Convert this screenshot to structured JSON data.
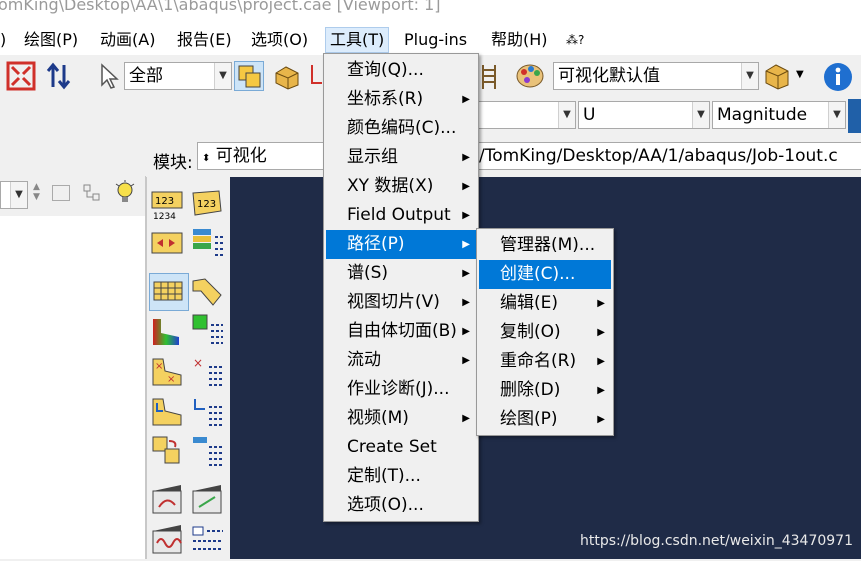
{
  "title": "omKing\\Desktop\\AA\\1\\abaqus\\project.cae [Viewport: 1]",
  "menubar": [
    {
      "label": ")"
    },
    {
      "label": "绘图(P)"
    },
    {
      "label": "动画(A)"
    },
    {
      "label": "报告(E)"
    },
    {
      "label": "选项(O)"
    },
    {
      "label": "工具(T)"
    },
    {
      "label": "Plug-ins"
    },
    {
      "label": "帮助(H)"
    },
    {
      "label": "⁂?"
    }
  ],
  "toolbar": {
    "display_group_combo": "全部",
    "default_combo": "可视化默认值",
    "field_combo": "U",
    "invariant_combo": "Magnitude"
  },
  "module_row": {
    "label": "模块:",
    "module_value": "可视化",
    "odb_path": "/TomKing/Desktop/AA/1/abaqus/Job-1out.c"
  },
  "tools_menu": {
    "items": [
      {
        "label": "查询(Q)...",
        "submenu": false
      },
      {
        "label": "坐标系(R)",
        "submenu": true
      },
      {
        "label": "颜色编码(C)...",
        "submenu": false
      },
      {
        "label": "显示组",
        "submenu": true
      },
      {
        "label": "XY 数据(X)",
        "submenu": true
      },
      {
        "label": "Field Output",
        "submenu": true
      },
      {
        "label": "路径(P)",
        "submenu": true
      },
      {
        "label": "谱(S)",
        "submenu": true
      },
      {
        "label": "视图切片(V)",
        "submenu": true
      },
      {
        "label": "自由体切面(B)",
        "submenu": true
      },
      {
        "label": "流动",
        "submenu": true
      },
      {
        "label": "作业诊断(J)...",
        "submenu": false
      },
      {
        "label": "视频(M)",
        "submenu": true
      },
      {
        "label": "Create Set",
        "submenu": false
      },
      {
        "label": "定制(T)...",
        "submenu": false
      },
      {
        "label": "选项(O)...",
        "submenu": false
      }
    ],
    "highlighted": "路径(P)"
  },
  "path_submenu": {
    "items": [
      {
        "label": "管理器(M)...",
        "submenu": false
      },
      {
        "label": "创建(C)...",
        "submenu": false
      },
      {
        "label": "编辑(E)",
        "submenu": true
      },
      {
        "label": "复制(O)",
        "submenu": true
      },
      {
        "label": "重命名(R)",
        "submenu": true
      },
      {
        "label": "删除(D)",
        "submenu": true
      },
      {
        "label": "绘图(P)",
        "submenu": true
      }
    ],
    "highlighted": "创建(C)..."
  },
  "watermark": "https://blog.csdn.net/weixin_43470971",
  "colors": {
    "viewport_bg": "#1f2b47",
    "menu_highlight": "#0078d7",
    "menubar_active": "#dcecfc"
  }
}
